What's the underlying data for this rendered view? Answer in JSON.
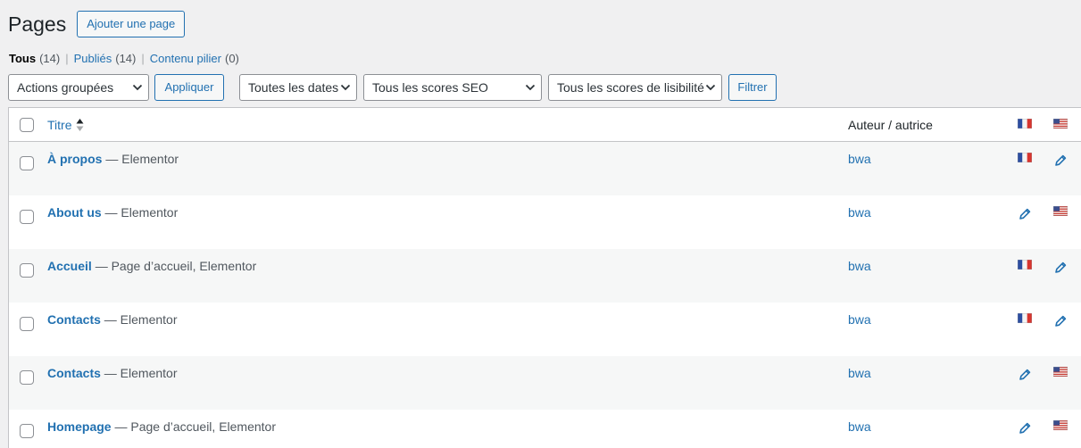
{
  "header": {
    "title": "Pages",
    "add_button": "Ajouter une page"
  },
  "views": [
    {
      "label": "Tous",
      "count": "(14)"
    },
    {
      "label": "Publiés",
      "count": "(14)"
    },
    {
      "label": "Contenu pilier",
      "count": "(0)"
    }
  ],
  "view_separator": "|",
  "filters": {
    "bulk_actions": "Actions groupées",
    "apply": "Appliquer",
    "dates": "Toutes les dates",
    "seo_scores": "Tous les scores SEO",
    "readability_scores": "Tous les scores de lisibilité",
    "filter_button": "Filtrer"
  },
  "table": {
    "columns": {
      "title": "Titre",
      "author": "Auteur / autrice"
    },
    "rows": [
      {
        "title": "À propos",
        "state": " — Elementor",
        "author": "bwa"
      },
      {
        "title": "About us",
        "state": " — Elementor",
        "author": "bwa"
      },
      {
        "title": "Accueil",
        "state": " — Page d’accueil, Elementor",
        "author": "bwa"
      },
      {
        "title": "Contacts",
        "state": " — Elementor",
        "author": "bwa"
      },
      {
        "title": "Contacts",
        "state": " — Elementor",
        "author": "bwa"
      },
      {
        "title": "Homepage",
        "state": " — Page d’accueil, Elementor",
        "author": "bwa"
      }
    ]
  },
  "icons": {
    "header_lang_1": "flag-fr-icon",
    "header_lang_2": "flag-us-icon",
    "row_lang_fr": [
      "flag-fr-icon",
      "pencil-icon",
      "flag-fr-icon",
      "flag-fr-icon",
      "pencil-icon",
      "pencil-icon"
    ],
    "row_lang_us": [
      "pencil-icon",
      "flag-us-icon",
      "pencil-icon",
      "pencil-icon",
      "flag-us-icon",
      "flag-us-icon"
    ]
  },
  "colors": {
    "link": "#2271b1",
    "background": "#f0f0f1",
    "row_alt": "#f6f7f7"
  }
}
